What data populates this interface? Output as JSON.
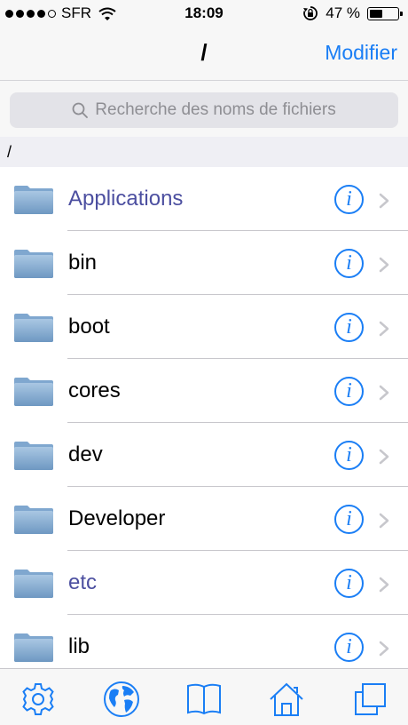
{
  "status_bar": {
    "carrier": "SFR",
    "time": "18:09",
    "battery_text": "47 %",
    "battery_level": 0.47
  },
  "nav": {
    "title": "/",
    "edit_label": "Modifier"
  },
  "search": {
    "placeholder": "Recherche des noms de fichiers"
  },
  "path_header": "/",
  "files": [
    {
      "name": "Applications",
      "symlink": true
    },
    {
      "name": "bin",
      "symlink": false
    },
    {
      "name": "boot",
      "symlink": false
    },
    {
      "name": "cores",
      "symlink": false
    },
    {
      "name": "dev",
      "symlink": false
    },
    {
      "name": "Developer",
      "symlink": false
    },
    {
      "name": "etc",
      "symlink": true
    },
    {
      "name": "lib",
      "symlink": false
    }
  ],
  "tabs": [
    "settings-icon",
    "globe-icon",
    "book-icon",
    "home-icon",
    "copy-icon"
  ],
  "colors": {
    "accent": "#1a7ef5",
    "symlink_text": "#4c4fa0",
    "folder": "#87aed3"
  }
}
